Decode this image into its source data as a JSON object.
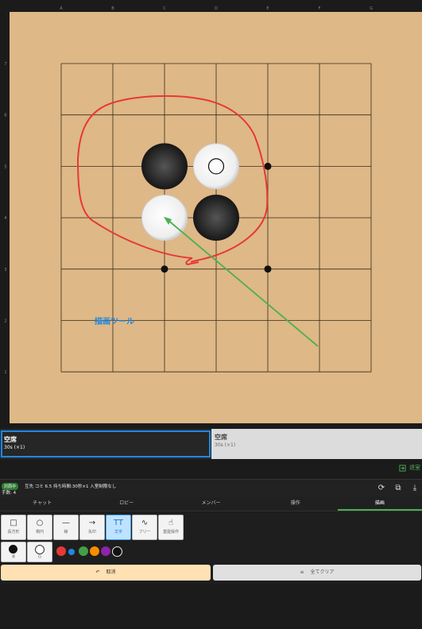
{
  "board": {
    "columns": [
      "A",
      "B",
      "C",
      "D",
      "E",
      "F",
      "G"
    ],
    "rows": [
      "7",
      "6",
      "5",
      "4",
      "3",
      "2",
      "1"
    ],
    "text_annotation": "描画ツール",
    "colors": {
      "board": "#deb887",
      "grid": "#3a2a1a",
      "freehand": "#e53935",
      "arrow": "#4caf50",
      "text": "#1e88e5"
    },
    "stones": [
      {
        "col": "C",
        "row": "5",
        "color": "black"
      },
      {
        "col": "D",
        "row": "5",
        "color": "white",
        "last_move": true
      },
      {
        "col": "C",
        "row": "4",
        "color": "white"
      },
      {
        "col": "D",
        "row": "4",
        "color": "black"
      }
    ],
    "star_points": [
      {
        "col": "E",
        "row": "5"
      },
      {
        "col": "C",
        "row": "3"
      },
      {
        "col": "E",
        "row": "3"
      }
    ]
  },
  "players": {
    "black": {
      "name": "空席",
      "time": "30s (×1)"
    },
    "white": {
      "name": "空席",
      "time": "30s (×1)"
    }
  },
  "leave_label": "退室",
  "info": {
    "status": "対局中",
    "game": "互先 コミ 6.5 持ち時間:30秒×1 入室制限なし",
    "moves": "手数: 4"
  },
  "tabs": [
    "チャット",
    "ロビー",
    "メンバー",
    "操作",
    "描画"
  ],
  "tools": [
    {
      "label": "長方形",
      "icon": "□"
    },
    {
      "label": "楕円",
      "icon": "○"
    },
    {
      "label": "線",
      "icon": "—"
    },
    {
      "label": "矢印",
      "icon": "→"
    },
    {
      "label": "文字",
      "icon": "TT"
    },
    {
      "label": "フリー",
      "icon": "∿"
    },
    {
      "label": "基盤操作",
      "icon": "☝"
    }
  ],
  "stone_picks": [
    {
      "label": "黒"
    },
    {
      "label": "白"
    }
  ],
  "palette": [
    "#e53935",
    "#1e88e5",
    "#43a047",
    "#fb8c00",
    "#8e24aa",
    "#111111"
  ],
  "cancel_label": "取消",
  "clear_label": "全てクリア"
}
